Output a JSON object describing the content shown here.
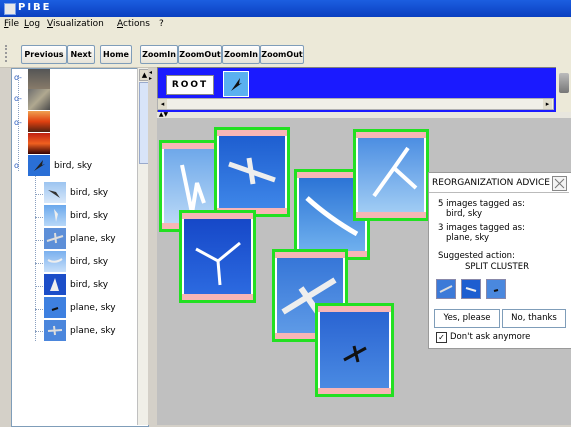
{
  "window": {
    "title": "PIBE"
  },
  "menu": [
    {
      "label": "File",
      "mn": "F",
      "rest": "ile"
    },
    {
      "label": "Log",
      "mn": "L",
      "rest": "og"
    },
    {
      "label": "Visualization",
      "mn": "V",
      "rest": "isualization"
    },
    {
      "label": "Actions",
      "mn": "A",
      "rest": "ctions"
    },
    {
      "label": "?",
      "mn": "",
      "rest": "?"
    }
  ],
  "toolbar": {
    "previous": "Previous",
    "next": "Next",
    "home": "Home",
    "zoomin1": "ZoomIn",
    "zoomout1": "ZoomOut",
    "zoomin2": "ZoomIn",
    "zoomout2": "ZoomOut"
  },
  "tree": {
    "cluster_label": "bird, sky",
    "children": [
      {
        "label": "bird, sky"
      },
      {
        "label": "bird, sky"
      },
      {
        "label": "plane, sky"
      },
      {
        "label": "bird, sky"
      },
      {
        "label": "bird, sky"
      },
      {
        "label": "plane, sky"
      },
      {
        "label": "plane, sky"
      }
    ]
  },
  "breadcrumb": {
    "root": "ROOT"
  },
  "advice": {
    "title": "REORGANIZATION ADVICE",
    "line1": "5 images tagged as:",
    "tag1": "bird, sky",
    "line2": "3 images tagged as:",
    "tag2": "plane, sky",
    "suggested": "Suggested action:",
    "action": "SPLIT CLUSTER",
    "yes": "Yes, please",
    "no": "No, thanks",
    "dont_ask": "Don't ask anymore"
  },
  "colors": {
    "selection": "#22e022",
    "tag_band": "#f7b6b6",
    "sky": "#2a6fd6",
    "root_bar": "#1a1aff"
  }
}
